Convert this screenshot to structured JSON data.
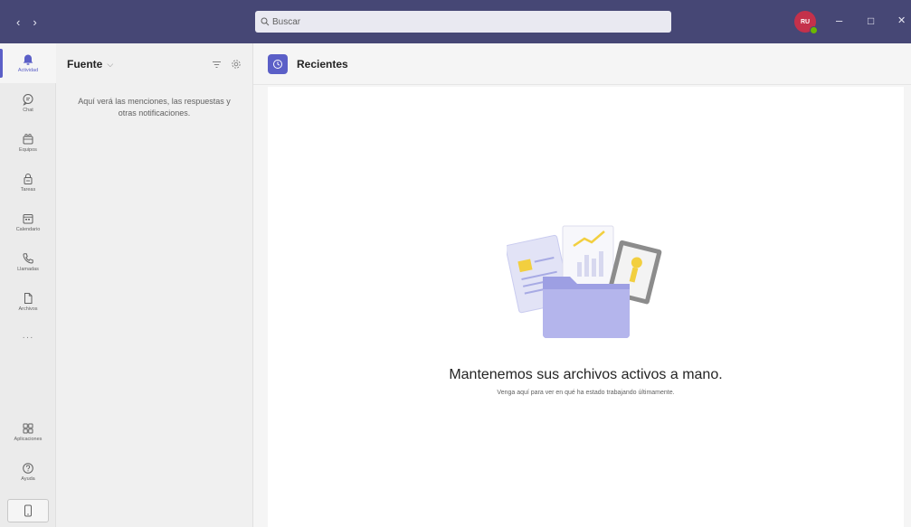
{
  "titlebar": {
    "back_glyph": "‹",
    "forward_glyph": "›",
    "search_placeholder": "Buscar",
    "avatar_initials": "RU",
    "minimize_glyph": "–",
    "maximize_glyph": "□",
    "close_glyph": "✕"
  },
  "rail": {
    "items": [
      {
        "label": "Actividad",
        "icon": "bell-icon"
      },
      {
        "label": "Chat",
        "icon": "chat-icon"
      },
      {
        "label": "Equipos",
        "icon": "teams-icon"
      },
      {
        "label": "Tareas",
        "icon": "tasks-icon"
      },
      {
        "label": "Calendario",
        "icon": "calendar-icon"
      },
      {
        "label": "Llamadas",
        "icon": "phone-icon"
      },
      {
        "label": "Archivos",
        "icon": "file-icon"
      }
    ],
    "more": "···",
    "apps": {
      "label": "Aplicaciones",
      "icon": "apps-icon"
    },
    "help": {
      "label": "Ayuda",
      "icon": "help-icon"
    }
  },
  "pane": {
    "title": "Fuente",
    "chevron": "⌵",
    "empty_text": "Aquí verá las menciones, las respuestas y otras notificaciones."
  },
  "main": {
    "title": "Recientes",
    "empty_title": "Mantenemos sus archivos activos a mano.",
    "empty_subtitle": "Venga aquí para ver en qué ha estado trabajando últimamente."
  },
  "colors": {
    "titlebar": "#464775",
    "accent": "#5b5fc7",
    "presence": "#6bb700"
  }
}
